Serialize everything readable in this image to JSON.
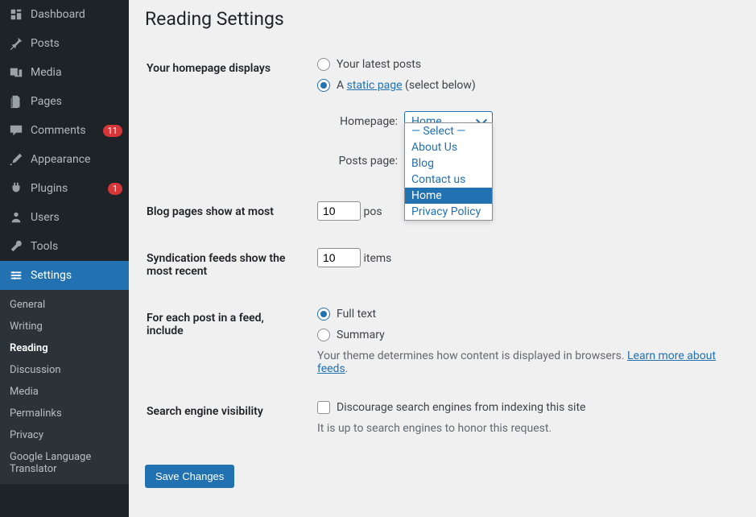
{
  "sidebar": {
    "items": [
      {
        "label": "Dashboard",
        "icon": "dashboard"
      },
      {
        "label": "Posts",
        "icon": "pin"
      },
      {
        "label": "Media",
        "icon": "media"
      },
      {
        "label": "Pages",
        "icon": "pages"
      },
      {
        "label": "Comments",
        "icon": "comment",
        "badge": "11"
      },
      {
        "label": "Appearance",
        "icon": "brush"
      },
      {
        "label": "Plugins",
        "icon": "plug",
        "badge": "1"
      },
      {
        "label": "Users",
        "icon": "user"
      },
      {
        "label": "Tools",
        "icon": "wrench"
      },
      {
        "label": "Settings",
        "icon": "settings",
        "current": true
      }
    ],
    "submenu": [
      {
        "label": "General"
      },
      {
        "label": "Writing"
      },
      {
        "label": "Reading",
        "active": true
      },
      {
        "label": "Discussion"
      },
      {
        "label": "Media"
      },
      {
        "label": "Permalinks"
      },
      {
        "label": "Privacy"
      },
      {
        "label": "Google Language Translator"
      }
    ]
  },
  "page": {
    "title": "Reading Settings",
    "homepage_label": "Your homepage displays",
    "radio_latest": "Your latest posts",
    "radio_static_prefix": "A ",
    "radio_static_link": "static page",
    "radio_static_suffix": " (select below)",
    "homepage_sel_label": "Homepage:",
    "homepage_sel_value": "Home",
    "posts_sel_label": "Posts page:",
    "dropdown_options": [
      "— Select —",
      "About Us",
      "Blog",
      "Contact us",
      "Home",
      "Privacy Policy"
    ],
    "dropdown_highlight": "Home",
    "blog_pages_label": "Blog pages show at most",
    "blog_pages_value": "10",
    "blog_pages_suffix": "pos",
    "syndication_label": "Syndication feeds show the most recent",
    "syndication_value": "10",
    "syndication_suffix": "items",
    "feed_label": "For each post in a feed, include",
    "feed_full": "Full text",
    "feed_summary": "Summary",
    "feed_desc_prefix": "Your theme determines how content is displayed in browsers. ",
    "feed_desc_link": "Learn more about feeds",
    "feed_desc_suffix": ".",
    "search_label": "Search engine visibility",
    "search_checkbox": "Discourage search engines from indexing this site",
    "search_desc": "It is up to search engines to honor this request.",
    "save_button": "Save Changes"
  }
}
